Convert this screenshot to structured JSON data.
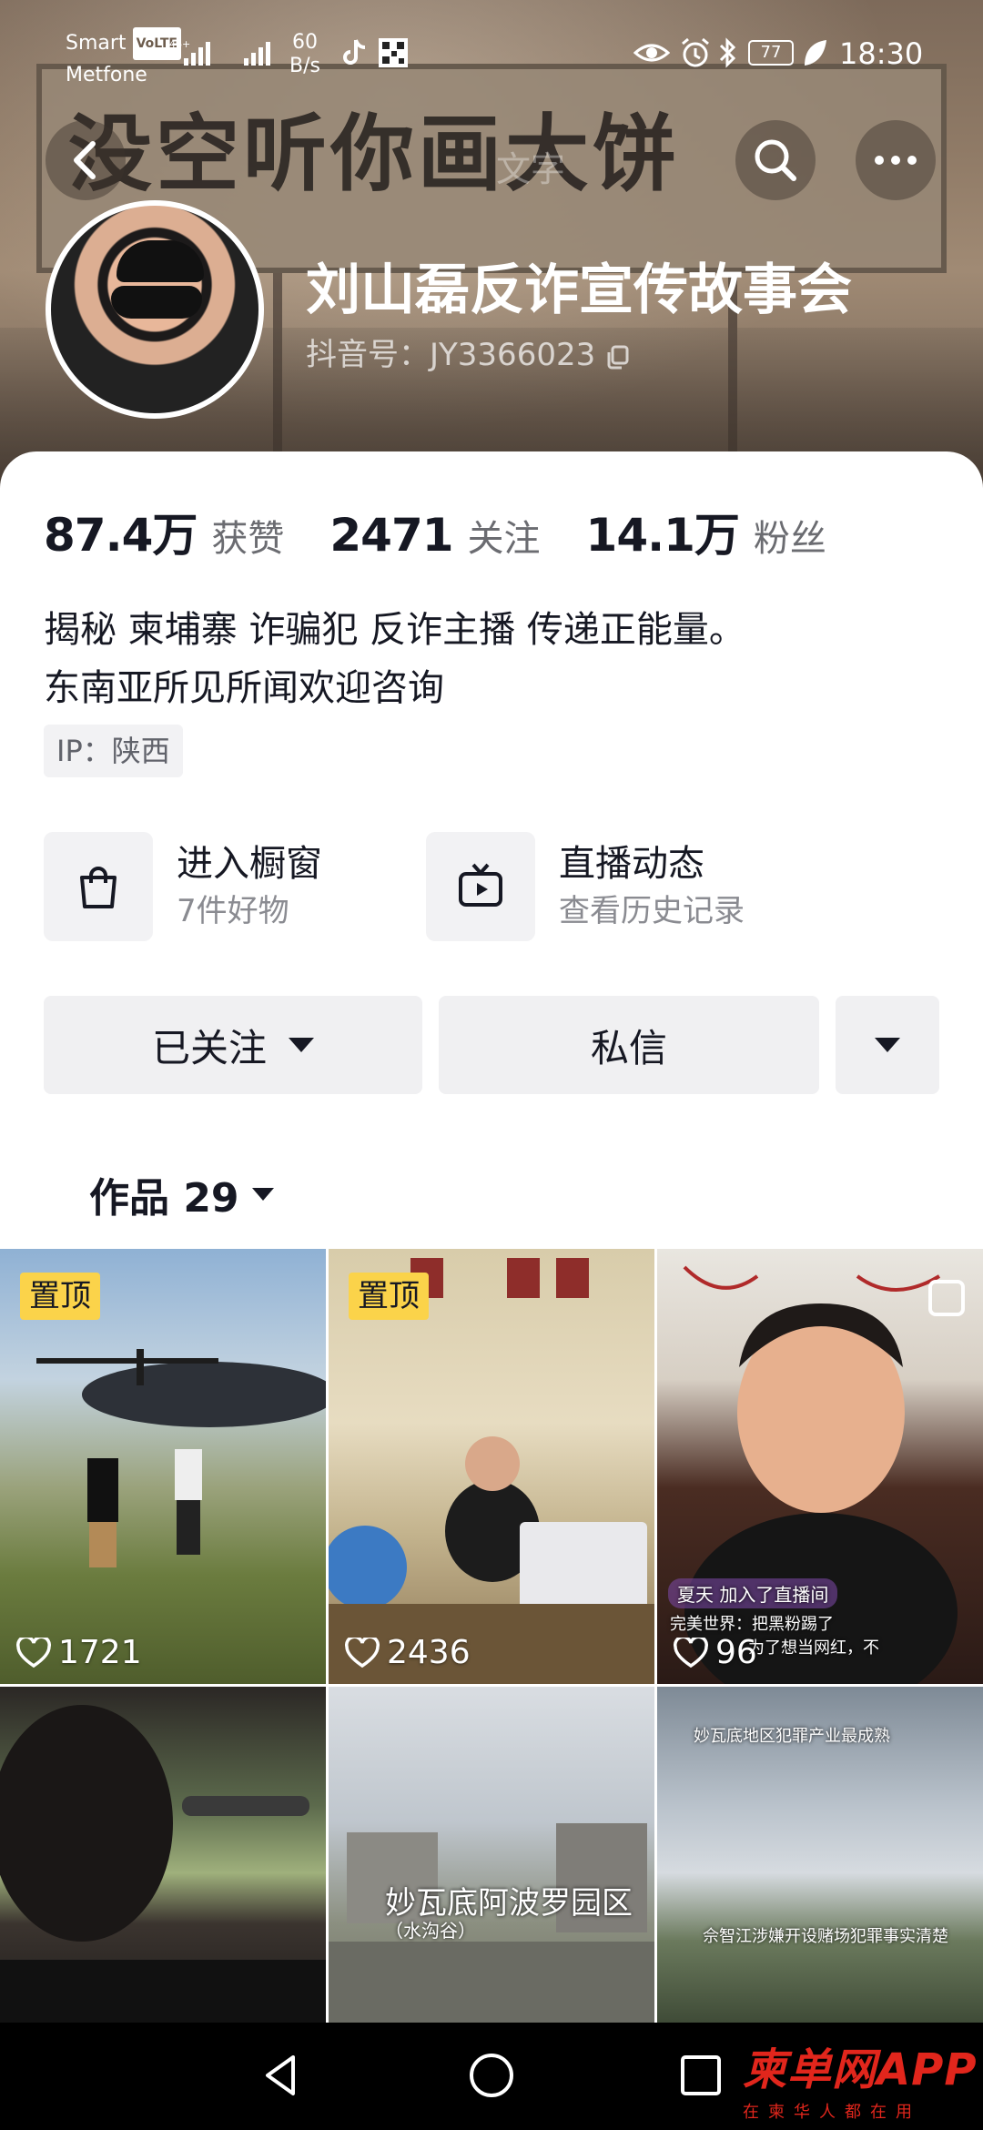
{
  "status_bar": {
    "carrier_line1": "Smart",
    "carrier_volte": "VoLTE",
    "carrier_line2": "Metfone",
    "signal1": "46+",
    "netspeed_value": "60",
    "netspeed_unit": "B/s",
    "battery": "77",
    "time": "18:30"
  },
  "banner": {
    "billboard_text": "没空听你画大饼",
    "search_hint": "文字"
  },
  "profile": {
    "nickname": "刘山磊反诈宣传故事会",
    "douyin_id": "抖音号：JY3366023"
  },
  "stats": [
    {
      "value": "87.4万",
      "label": "获赞"
    },
    {
      "value": "2471",
      "label": "关注"
    },
    {
      "value": "14.1万",
      "label": "粉丝"
    }
  ],
  "bio": {
    "line1": "揭秘 柬埔寨 诈骗犯 反诈主播 传递正能量。",
    "line2": "东南亚所见所闻欢迎咨询",
    "ip": "IP：陕西"
  },
  "entries": [
    {
      "title": "进入橱窗",
      "subtitle": "7件好物",
      "icon": "shopping-bag-icon"
    },
    {
      "title": "直播动态",
      "subtitle": "查看历史记录",
      "icon": "tv-icon"
    }
  ],
  "actions": {
    "follow": "已关注",
    "message": "私信"
  },
  "works_tab": {
    "label": "作品 29"
  },
  "videos": [
    {
      "pinned": "置顶",
      "likes": "1721"
    },
    {
      "pinned": "置顶",
      "likes": "2436"
    },
    {
      "likes": "96",
      "overlay_join": "夏天 加入了直播间",
      "overlay_comment1": "完美世界：把黑粉踢了",
      "overlay_comment2": "为了想当网红，不"
    },
    {},
    {
      "caption_main": "妙瓦底阿波罗园区",
      "caption_sub": "（水沟谷）"
    },
    {
      "caption_top": "妙瓦底地区犯罪产业最成熟",
      "caption_bottom": "佘智江涉嫌开设赌场犯罪事实清楚"
    }
  ],
  "watermark": {
    "main": "柬单网APP",
    "sub": "在柬华人都在用"
  },
  "colors": {
    "pin_yellow": "#fbd34a",
    "watermark_red": "#e1261c"
  }
}
